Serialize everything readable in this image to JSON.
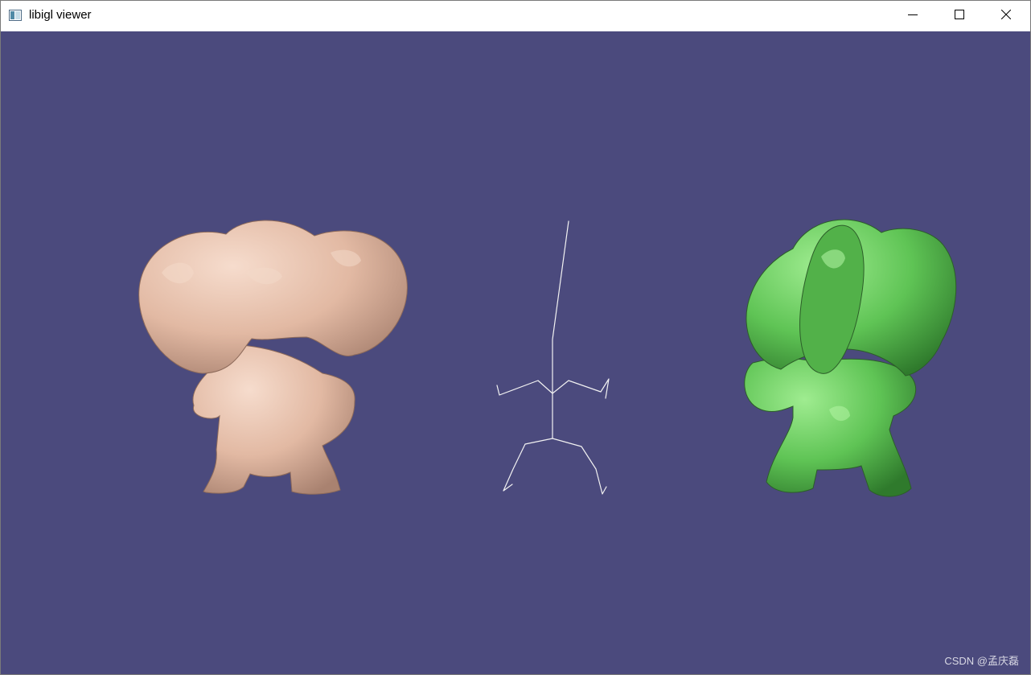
{
  "window": {
    "title": "libigl viewer",
    "icon": "app-window-icon",
    "controls": {
      "minimize_icon": "minimize-icon",
      "maximize_icon": "maximize-icon",
      "close_icon": "close-icon"
    }
  },
  "viewport": {
    "background_color": "#4b4a7d",
    "models": [
      {
        "name": "skinned-mesh-left",
        "color": "#e7c1ad"
      },
      {
        "name": "skeleton-wireframe",
        "color": "#f2f2f2"
      },
      {
        "name": "skinned-mesh-right",
        "color": "#6fd167"
      }
    ]
  },
  "watermark": "CSDN @孟庆磊"
}
